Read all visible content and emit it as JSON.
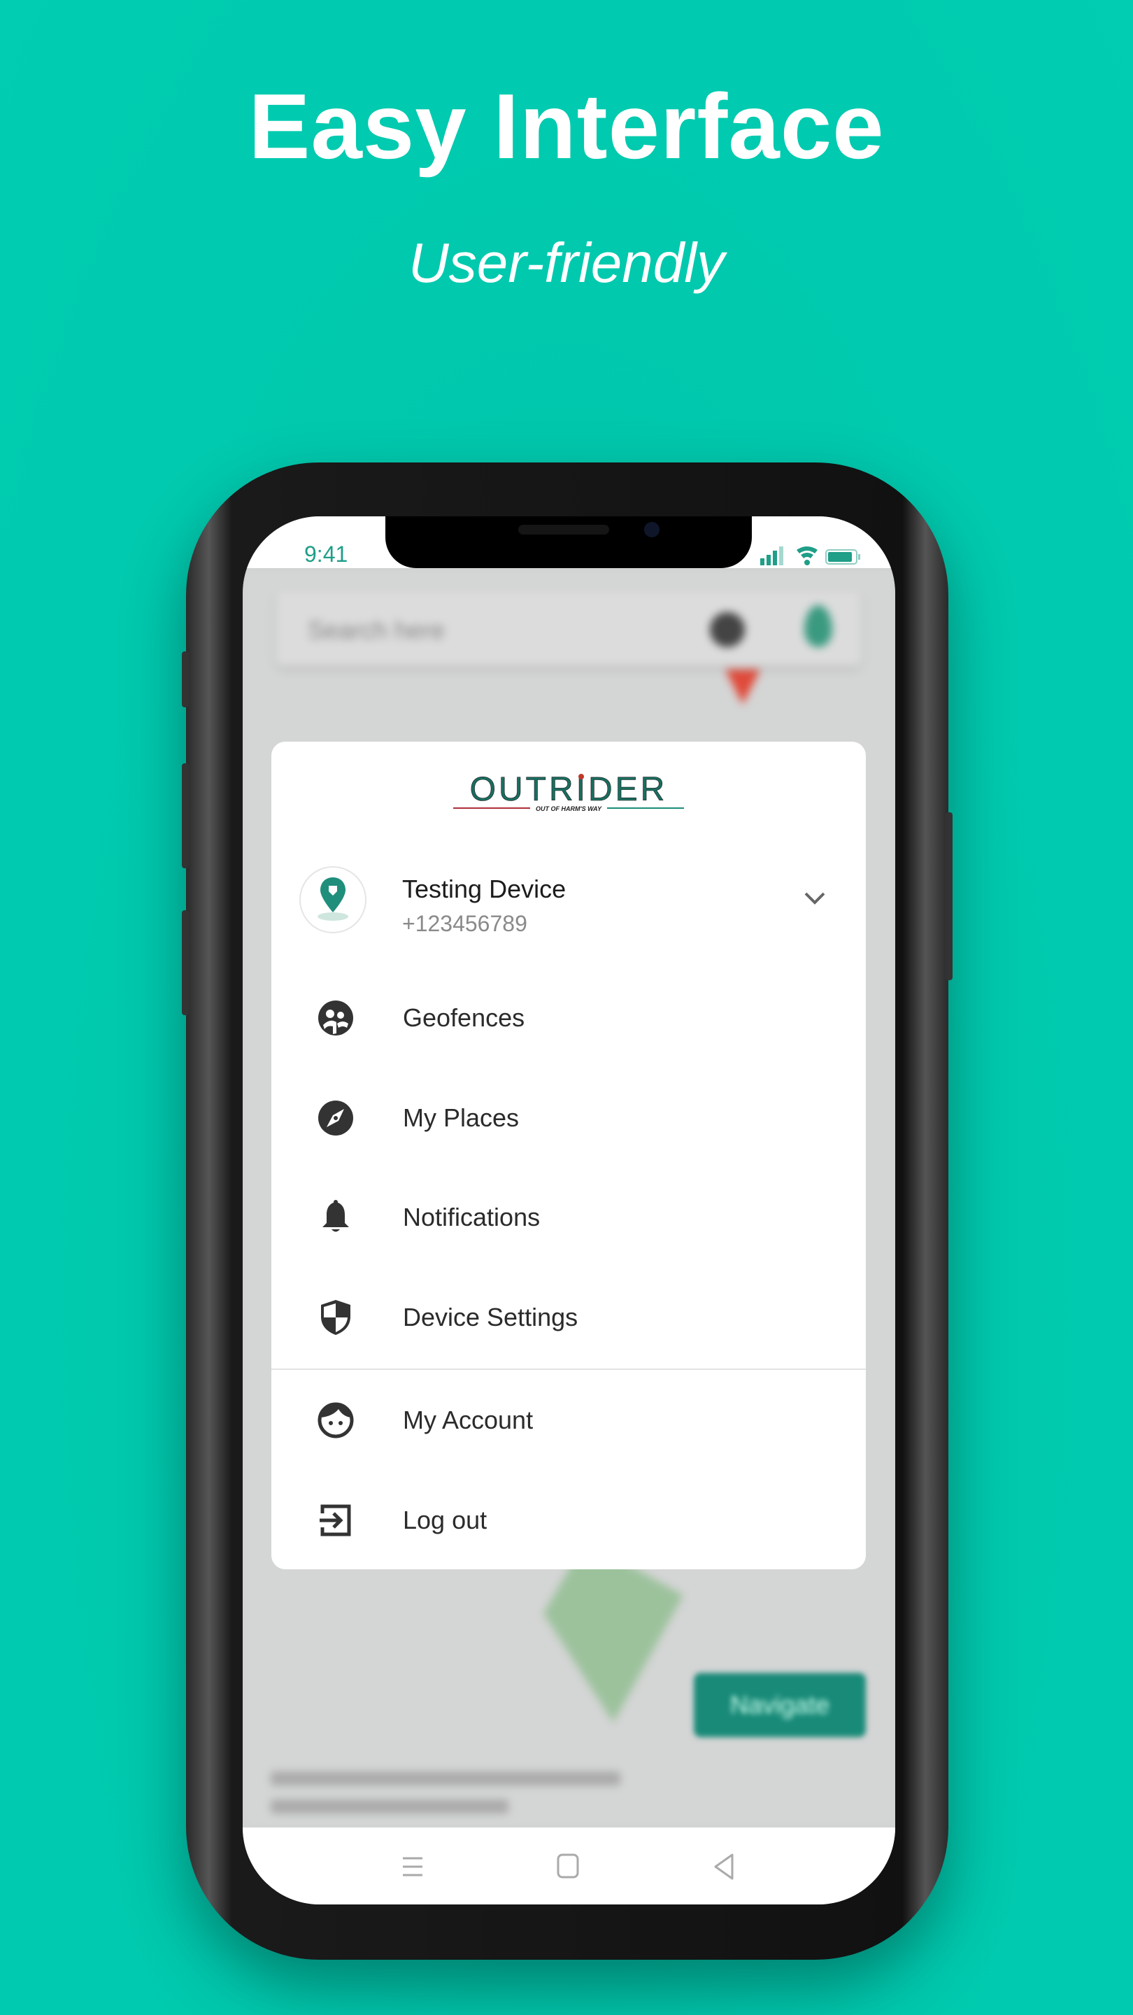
{
  "hero": {
    "title": "Easy Interface",
    "subtitle": "User-friendly"
  },
  "status_bar": {
    "time": "9:41",
    "icons": [
      "signal-icon",
      "wifi-icon",
      "battery-icon"
    ]
  },
  "background_app": {
    "search_placeholder": "Search here",
    "navigate_label": "Navigate"
  },
  "menu": {
    "logo": {
      "text": "OUTRIDER",
      "tagline": "OUT OF HARM'S WAY"
    },
    "device": {
      "name": "Testing Device",
      "phone": "+123456789"
    },
    "items": [
      {
        "label": "Geofences",
        "icon": "geofence-icon"
      },
      {
        "label": "My Places",
        "icon": "compass-icon"
      },
      {
        "label": "Notifications",
        "icon": "bell-icon"
      },
      {
        "label": "Device Settings",
        "icon": "shield-icon"
      }
    ],
    "account_items": [
      {
        "label": "My Account",
        "icon": "face-icon"
      },
      {
        "label": "Log out",
        "icon": "logout-icon"
      }
    ]
  },
  "nav_bar": {
    "icons": [
      "recents-icon",
      "home-icon",
      "back-icon"
    ]
  },
  "colors": {
    "background": "#00C9AE",
    "accent": "#1F9E88",
    "button": "#198A78"
  }
}
